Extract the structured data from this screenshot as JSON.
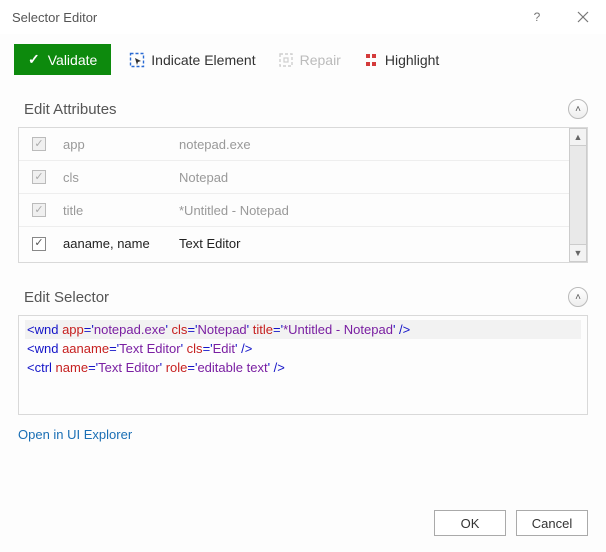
{
  "window": {
    "title": "Selector Editor"
  },
  "toolbar": {
    "validate": "Validate",
    "indicate": "Indicate Element",
    "repair": "Repair",
    "highlight": "Highlight"
  },
  "sections": {
    "attributes_title": "Edit Attributes",
    "selector_title": "Edit Selector"
  },
  "attributes": [
    {
      "checked": true,
      "enabled": false,
      "name": "app",
      "value": "notepad.exe"
    },
    {
      "checked": true,
      "enabled": false,
      "name": "cls",
      "value": "Notepad"
    },
    {
      "checked": true,
      "enabled": false,
      "name": "title",
      "value": "*Untitled - Notepad"
    },
    {
      "checked": true,
      "enabled": true,
      "name": "aaname, name",
      "value": "Text Editor"
    }
  ],
  "selector_lines": [
    {
      "tag": "wnd",
      "attrs": [
        [
          "app",
          "notepad.exe"
        ],
        [
          "cls",
          "Notepad"
        ],
        [
          "title",
          "*Untitled - Notepad"
        ]
      ]
    },
    {
      "tag": "wnd",
      "attrs": [
        [
          "aaname",
          "Text Editor"
        ],
        [
          "cls",
          "Edit"
        ]
      ]
    },
    {
      "tag": "ctrl",
      "attrs": [
        [
          "name",
          "Text Editor"
        ],
        [
          "role",
          "editable text"
        ]
      ]
    }
  ],
  "link": "Open in UI Explorer",
  "footer": {
    "ok": "OK",
    "cancel": "Cancel"
  }
}
